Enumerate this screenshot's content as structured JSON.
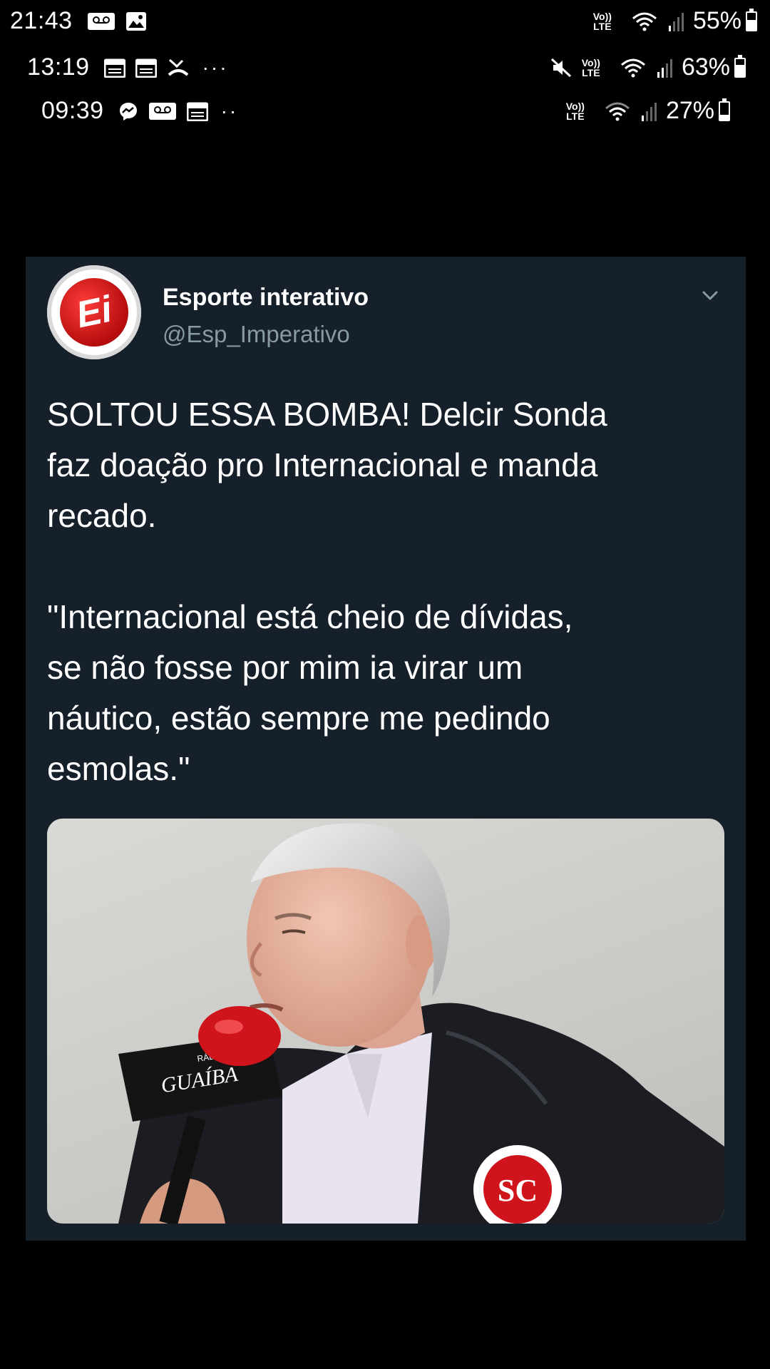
{
  "status_bars": [
    {
      "time": "21:43",
      "battery": "55%",
      "battery_level": 0.55
    },
    {
      "time": "13:19",
      "battery": "63%",
      "battery_level": 0.63
    },
    {
      "time": "09:39",
      "battery": "27%",
      "battery_level": 0.27
    }
  ],
  "network_label_top": "Vo))",
  "network_label_bottom": "LTE",
  "status_dots": "···",
  "tweet": {
    "account_name": "Esporte interativo",
    "handle": "@Esp_Imperativo",
    "avatar_text": "Ei",
    "text_lines_1": [
      "SOLTOU ESSA BOMBA! Delcir Sonda",
      "faz doação pro Internacional e manda",
      "recado."
    ],
    "text_lines_2": [
      "\"Internacional está cheio de dívidas,",
      "se não fosse por mim ia virar um",
      "náutico, estão sempre me pedindo",
      "esmolas.\""
    ]
  },
  "photo": {
    "mic_brand": "GUAÍBA",
    "mic_station": "RÁDIO"
  },
  "colors": {
    "card_bg": "#15202b",
    "handle_gray": "#8899a6",
    "mic_red": "#d0141c"
  },
  "icons": [
    "voicemail-icon",
    "image-icon",
    "calendar-icon",
    "missed-call-icon",
    "messenger-icon",
    "mute-icon",
    "wifi-icon",
    "signal-icon",
    "battery-icon",
    "chevron-down-icon"
  ]
}
